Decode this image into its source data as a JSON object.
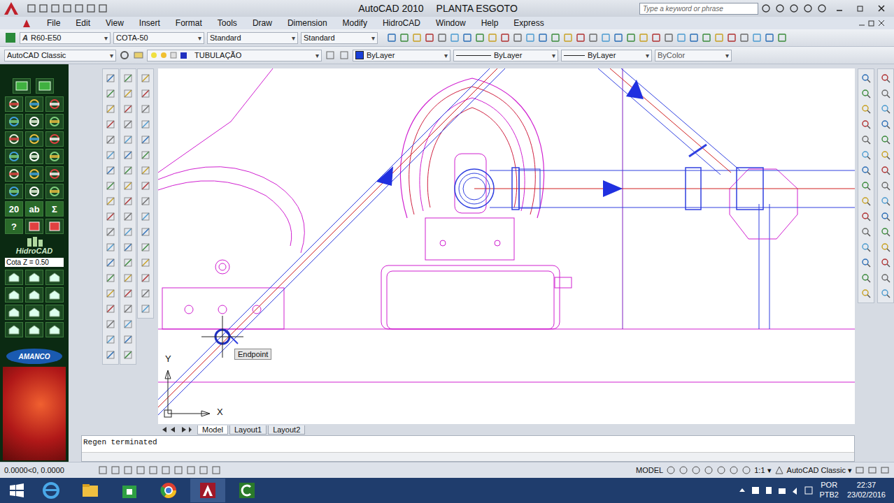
{
  "window": {
    "app": "AutoCAD 2010",
    "document": "PLANTA ESGOTO"
  },
  "search": {
    "placeholder": "Type a keyword or phrase"
  },
  "menu": [
    "File",
    "Edit",
    "View",
    "Insert",
    "Format",
    "Tools",
    "Draw",
    "Dimension",
    "Modify",
    "HidroCAD",
    "Window",
    "Help",
    "Express"
  ],
  "styles_toolbar": {
    "text_style": "R60-E50",
    "dim_style": "COTA-50",
    "table_style": "Standard",
    "multileader_style": "Standard"
  },
  "properties_toolbar": {
    "workspace": "AutoCAD Classic",
    "layer": "TUBULAÇÃO",
    "color": "ByLayer",
    "linetype": "ByLayer",
    "lineweight": "ByLayer",
    "plot_style": "ByColor"
  },
  "palette": {
    "glyph_buttons": [
      "20",
      "ab",
      "Σ",
      "?"
    ],
    "brand": "HidroCAD",
    "cota": "Cota Z = 0.50",
    "logo": "AMANCO"
  },
  "drawing": {
    "snap_tooltip": "Endpoint",
    "axis_x": "X",
    "axis_y": "Y"
  },
  "layout_tabs": [
    {
      "label": "Model",
      "selected": true
    },
    {
      "label": "Layout1",
      "selected": false
    },
    {
      "label": "Layout2",
      "selected": false
    }
  ],
  "command_line": {
    "history": "Regen terminated"
  },
  "status_bar": {
    "coordinates": "0.0000<0, 0.0000",
    "space": "MODEL",
    "scale": "1:1",
    "workspace": "AutoCAD Classic"
  },
  "taskbar": {
    "language": "POR",
    "layout": "PTB2",
    "time": "22:37",
    "date": "23/02/2016"
  }
}
